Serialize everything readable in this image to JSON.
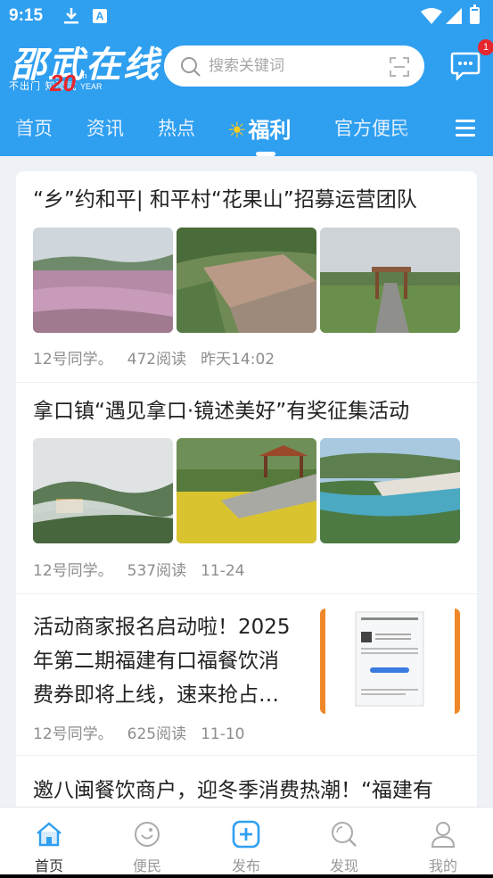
{
  "status_bar": {
    "time": "9:15"
  },
  "logo": {
    "name": "邵武在线",
    "slogan": "不出门      知邵武",
    "twenty": "20",
    "th": "th",
    "year": "YEAR"
  },
  "search": {
    "placeholder": "搜索关键词"
  },
  "messages": {
    "badge": "1"
  },
  "tabs": [
    {
      "label": "首页"
    },
    {
      "label": "资讯"
    },
    {
      "label": "热点"
    },
    {
      "label": "福利",
      "active": true
    },
    {
      "label": "官方便民"
    }
  ],
  "articles": [
    {
      "title": "“乡”约和平| 和平村“花果山”招募运营团队",
      "author": "12号同学。",
      "reads": "472阅读",
      "time": "昨天14:02"
    },
    {
      "title": "拿口镇“遇见拿口·镜述美好”有奖征集活动",
      "author": "12号同学。",
      "reads": "537阅读",
      "time": "11-24"
    },
    {
      "title_lines": [
        "活动商家报名启动啦！2025",
        "年第二期福建有口福餐饮消",
        "费券即将上线，速来抢占…"
      ],
      "author": "12号同学。",
      "reads": "625阅读",
      "time": "11-10"
    },
    {
      "title": "邀八闽餐饮商户，迎冬季消费热潮！“福建有"
    }
  ],
  "bottom_nav": [
    {
      "label": "首页",
      "icon": "home-icon",
      "active": true
    },
    {
      "label": "便民",
      "icon": "convenience-icon"
    },
    {
      "label": "发布",
      "icon": "publish-plus-icon"
    },
    {
      "label": "发现",
      "icon": "discover-icon"
    },
    {
      "label": "我的",
      "icon": "profile-icon"
    }
  ],
  "colors": {
    "brand_blue": "#2f9ff0",
    "badge_red": "#e6282e",
    "nav_active": "#2f9ff0"
  }
}
